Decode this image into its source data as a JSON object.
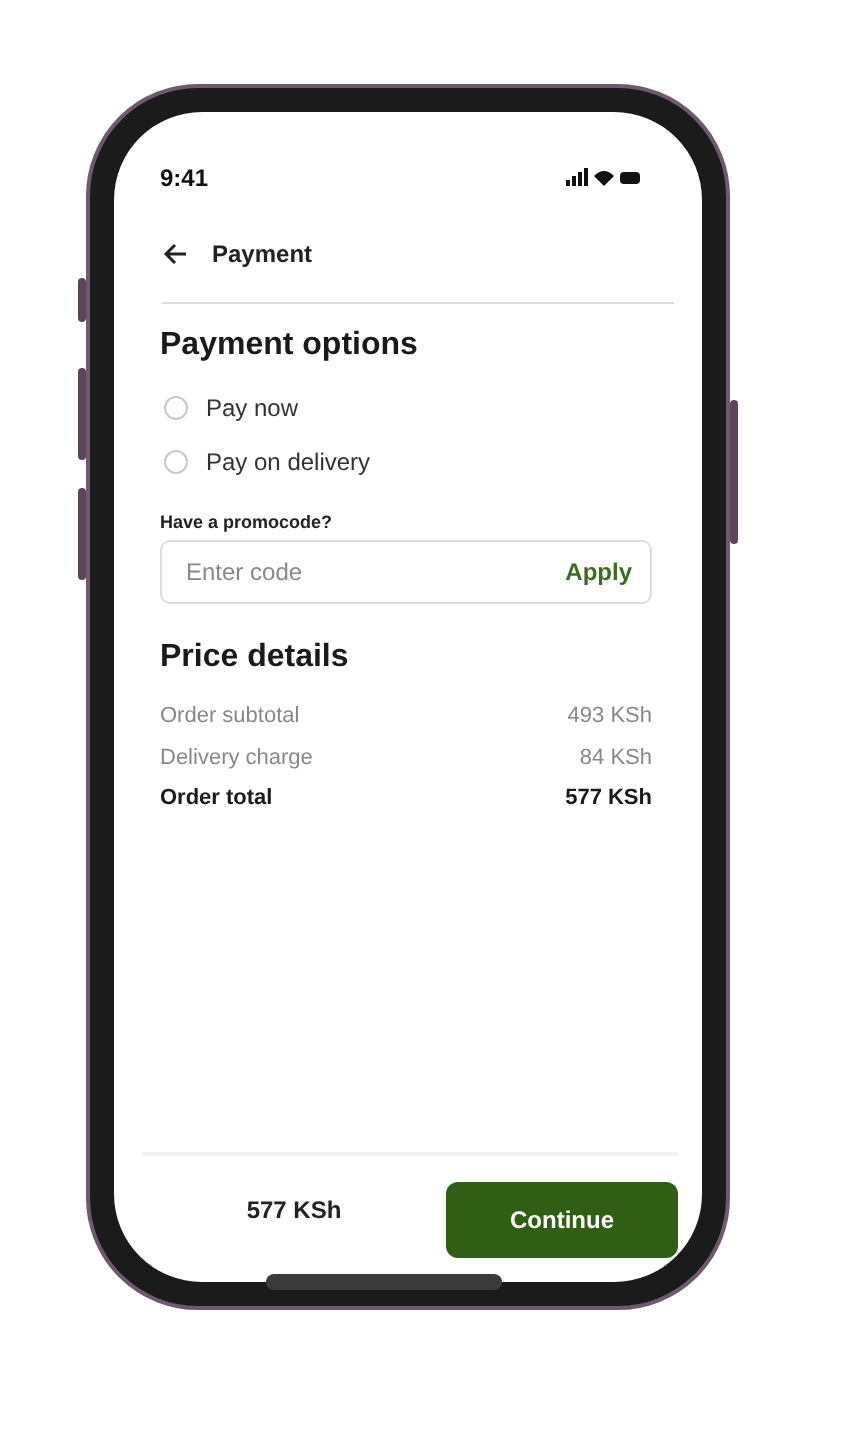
{
  "status_bar": {
    "time": "9:41"
  },
  "header": {
    "title": "Payment"
  },
  "payment_options": {
    "title": "Payment options",
    "options": [
      {
        "label": "Pay now",
        "selected": false
      },
      {
        "label": "Pay on delivery",
        "selected": false
      }
    ]
  },
  "promocode": {
    "label": "Have a promocode?",
    "placeholder": "Enter code",
    "action": "Apply"
  },
  "price_details": {
    "title": "Price details",
    "rows": [
      {
        "label": "Order subtotal",
        "value": "493 KSh",
        "kind": "line"
      },
      {
        "label": "Delivery charge",
        "value": "84 KSh",
        "kind": "line"
      },
      {
        "label": "Order total",
        "value": "577 KSh",
        "kind": "total"
      }
    ]
  },
  "footer": {
    "total": "577 KSh",
    "button": "Continue"
  }
}
